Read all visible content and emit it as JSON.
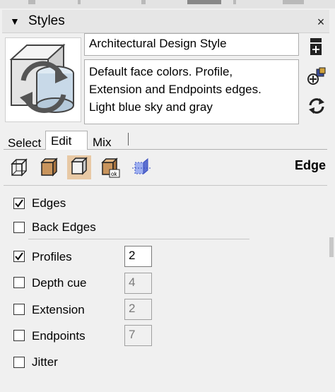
{
  "panel": {
    "title": "Styles",
    "close_glyph": "×"
  },
  "style": {
    "name": "Architectural Design Style",
    "description": [
      "Default face colors. Profile,",
      "Extension and Endpoints edges.",
      "Light blue sky and gray"
    ]
  },
  "side_icons": [
    "create-style-icon",
    "update-style-icon",
    "refresh-icon"
  ],
  "tabs": [
    {
      "label": "Select",
      "selected": false
    },
    {
      "label": "Edit",
      "selected": true
    },
    {
      "label": "Mix",
      "selected": false
    }
  ],
  "edit_toolbar": {
    "section_title": "Edge",
    "buttons": [
      "edge-settings-icon",
      "face-settings-icon",
      "background-settings-icon",
      "watermark-settings-icon",
      "modeling-settings-icon"
    ],
    "active_index": 2
  },
  "edge_options": [
    {
      "label": "Edges",
      "checked": true
    },
    {
      "label": "Back Edges",
      "checked": false
    },
    {
      "label": "Profiles",
      "checked": true,
      "value": "2",
      "enabled": true
    },
    {
      "label": "Depth cue",
      "checked": false,
      "value": "4",
      "enabled": false
    },
    {
      "label": "Extension",
      "checked": false,
      "value": "2",
      "enabled": false
    },
    {
      "label": "Endpoints",
      "checked": false,
      "value": "7",
      "enabled": false
    },
    {
      "label": "Jitter",
      "checked": false
    }
  ],
  "colors": {
    "active_tool_bg": "#e8c9a5",
    "panel_bg": "#f0f0f0"
  }
}
